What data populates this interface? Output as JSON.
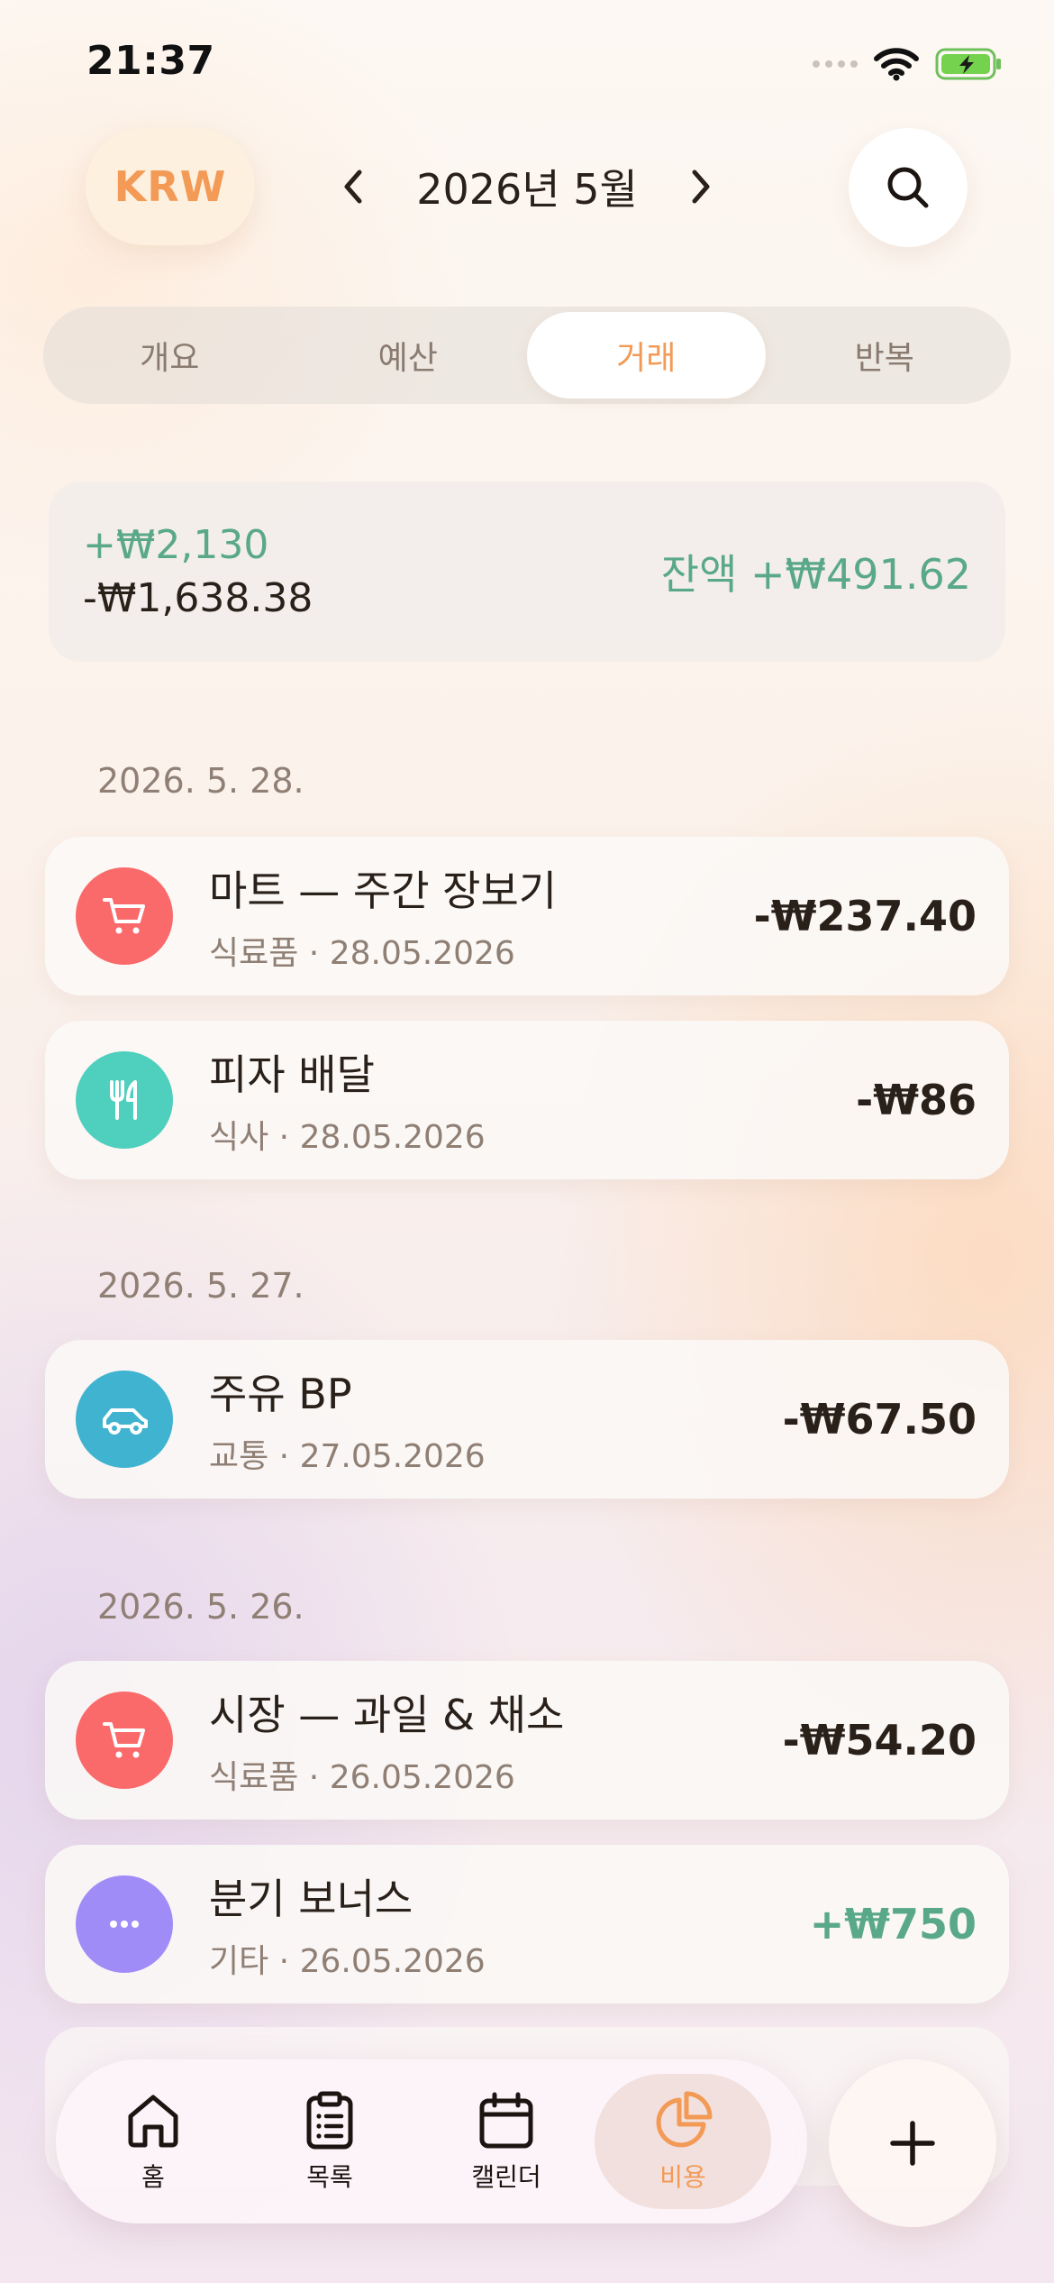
{
  "status_bar": {
    "time": "21:37"
  },
  "header": {
    "currency": "KRW",
    "month": "2026년 5월",
    "icons": {
      "prev": "chevron-left-icon",
      "next": "chevron-right-icon",
      "search": "search-icon"
    }
  },
  "tabs": [
    {
      "label": "개요",
      "active": false
    },
    {
      "label": "예산",
      "active": false
    },
    {
      "label": "거래",
      "active": true
    },
    {
      "label": "반복",
      "active": false
    }
  ],
  "summary": {
    "income": "+₩2,130",
    "expense": "-₩1,638.38",
    "balance": "잔액 +₩491.62"
  },
  "groups": [
    {
      "date": "2026. 5. 28.",
      "items": [
        {
          "title": "마트 — 주간 장보기",
          "subtitle": "식료품 · 28.05.2026",
          "amount": "-₩237.40",
          "icon": "cart-icon",
          "color": "#fb6a6a"
        },
        {
          "title": "피자 배달",
          "subtitle": "식사 · 28.05.2026",
          "amount": "-₩86",
          "icon": "fork-knife-icon",
          "color": "#4fcfbd"
        }
      ]
    },
    {
      "date": "2026. 5. 27.",
      "items": [
        {
          "title": "주유 BP",
          "subtitle": "교통 · 27.05.2026",
          "amount": "-₩67.50",
          "icon": "car-icon",
          "color": "#3fb3cf"
        }
      ]
    },
    {
      "date": "2026. 5. 26.",
      "items": [
        {
          "title": "시장 — 과일 & 채소",
          "subtitle": "식료품 · 26.05.2026",
          "amount": "-₩54.20",
          "icon": "cart-icon",
          "color": "#fb6a6a"
        },
        {
          "title": "분기 보너스",
          "subtitle": "기타 · 26.05.2026",
          "amount": "+₩750",
          "icon": "more-icon",
          "color": "#9f8cf7"
        }
      ]
    }
  ],
  "tabbar": [
    {
      "label": "홈",
      "icon": "home-icon",
      "active": false
    },
    {
      "label": "목록",
      "icon": "clipboard-list-icon",
      "active": false
    },
    {
      "label": "캘린더",
      "icon": "calendar-icon",
      "active": false
    },
    {
      "label": "비용",
      "icon": "pie-chart-icon",
      "active": true
    }
  ],
  "fab": {
    "icon": "plus-icon"
  },
  "colors": {
    "accent": "#f29a56",
    "positive": "#5aa88a"
  }
}
